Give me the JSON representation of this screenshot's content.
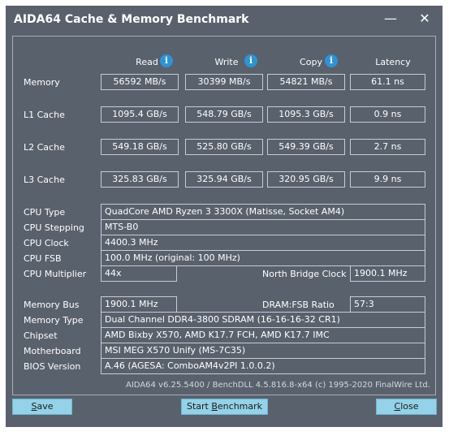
{
  "window": {
    "title": "AIDA64 Cache & Memory Benchmark",
    "minimize_glyph": "—",
    "close_glyph": "✕"
  },
  "columns": {
    "read": "Read",
    "write": "Write",
    "copy": "Copy",
    "latency": "Latency",
    "info_glyph": "i"
  },
  "bench": [
    {
      "label": "Memory",
      "read": "56592 MB/s",
      "write": "30399 MB/s",
      "copy": "54821 MB/s",
      "latency": "61.1 ns"
    },
    {
      "label": "L1 Cache",
      "read": "1095.4 GB/s",
      "write": "548.79 GB/s",
      "copy": "1095.3 GB/s",
      "latency": "0.9 ns"
    },
    {
      "label": "L2 Cache",
      "read": "549.18 GB/s",
      "write": "525.80 GB/s",
      "copy": "549.39 GB/s",
      "latency": "2.7 ns"
    },
    {
      "label": "L3 Cache",
      "read": "325.83 GB/s",
      "write": "325.94 GB/s",
      "copy": "320.95 GB/s",
      "latency": "9.9 ns"
    }
  ],
  "cpu": {
    "type_label": "CPU Type",
    "type": "QuadCore AMD Ryzen 3 3300X  (Matisse, Socket AM4)",
    "stepping_label": "CPU Stepping",
    "stepping": "MTS-B0",
    "clock_label": "CPU Clock",
    "clock": "4400.3 MHz",
    "fsb_label": "CPU FSB",
    "fsb": "100.0 MHz  (original: 100 MHz)",
    "multiplier_label": "CPU Multiplier",
    "multiplier": "44x",
    "nb_clock_label": "North Bridge Clock",
    "nb_clock": "1900.1 MHz"
  },
  "system": {
    "bus_label": "Memory Bus",
    "bus": "1900.1 MHz",
    "ratio_label": "DRAM:FSB Ratio",
    "ratio": "57:3",
    "memtype_label": "Memory Type",
    "memtype": "Dual Channel DDR4-3800 SDRAM  (16-16-16-32 CR1)",
    "chipset_label": "Chipset",
    "chipset": "AMD Bixby X570, AMD K17.7 FCH, AMD K17.7 IMC",
    "mobo_label": "Motherboard",
    "mobo": "MSI MEG X570 Unify (MS-7C35)",
    "bios_label": "BIOS Version",
    "bios": "A.46  (AGESA: ComboAM4v2PI 1.0.0.2)"
  },
  "footer": "AIDA64 v6.25.5400 / BenchDLL 4.5.816.8-x64  (c) 1995-2020 FinalWire Ltd.",
  "buttons": {
    "save_accel": "S",
    "save_rest": "ave",
    "start_pre": "Start ",
    "start_accel": "B",
    "start_rest": "enchmark",
    "close_accel": "C",
    "close_rest": "lose"
  },
  "colors": {
    "window_bg": "#59616d",
    "button_bg": "#93d2e8",
    "info_icon": "#2e93d6",
    "border": "#c7ccd3"
  }
}
